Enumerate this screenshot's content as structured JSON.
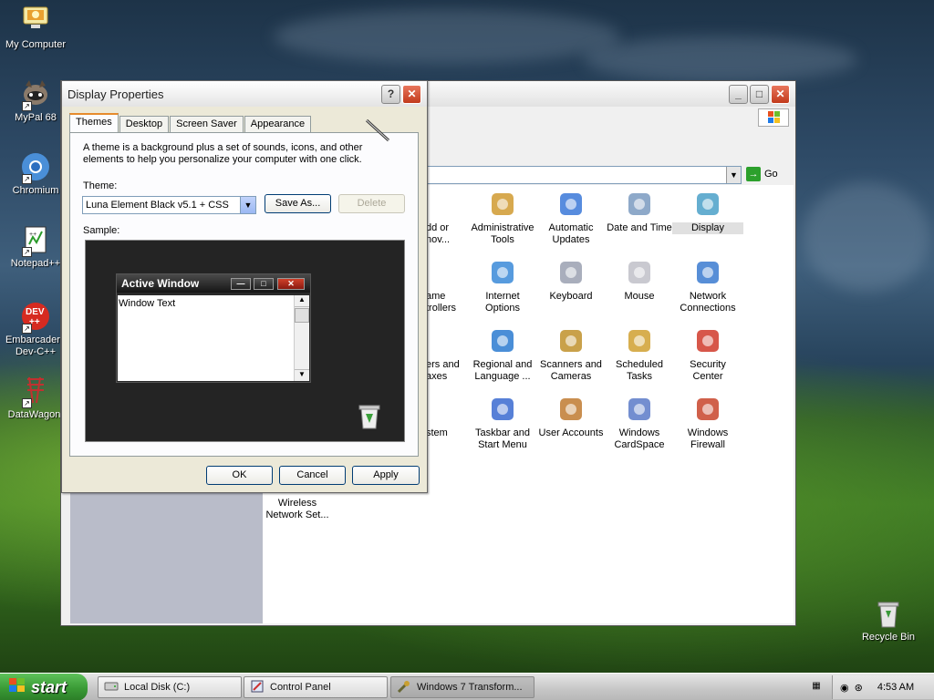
{
  "desktop": {
    "icons": [
      {
        "label": "My Computer"
      },
      {
        "label": "MyPal 68"
      },
      {
        "label": "Chromium"
      },
      {
        "label": "Notepad++"
      },
      {
        "label": "Embarcadero Dev-C++"
      },
      {
        "label": "DataWagon."
      },
      {
        "label": "Recycle Bin"
      }
    ]
  },
  "control_panel": {
    "go_label": "Go",
    "items": [
      {
        "label": "dd or\nnov..."
      },
      {
        "label": "Administrative\nTools"
      },
      {
        "label": "Automatic\nUpdates"
      },
      {
        "label": "Date and Time"
      },
      {
        "label": "Display"
      },
      {
        "label": "ame\ntrollers"
      },
      {
        "label": "Internet\nOptions"
      },
      {
        "label": "Keyboard"
      },
      {
        "label": "Mouse"
      },
      {
        "label": "Network\nConnections"
      },
      {
        "label": "ers and\naxes"
      },
      {
        "label": "Regional and\nLanguage ..."
      },
      {
        "label": "Scanners and\nCameras"
      },
      {
        "label": "Scheduled\nTasks"
      },
      {
        "label": "Security\nCenter"
      },
      {
        "label": "stem"
      },
      {
        "label": "Taskbar and\nStart Menu"
      },
      {
        "label": "User Accounts"
      },
      {
        "label": "Windows\nCardSpace"
      },
      {
        "label": "Windows\nFirewall"
      },
      {
        "label": "Wireless\nNetwork Set..."
      }
    ]
  },
  "dialog": {
    "title": "Display Properties",
    "tabs": [
      "Themes",
      "Desktop",
      "Screen Saver",
      "Appearance"
    ],
    "description": "A theme is a background plus a set of sounds, icons, and other elements to help you personalize your computer with one click.",
    "theme_label": "Theme:",
    "theme_value": "Luna Element Black v5.1 + CSS",
    "save_as": "Save As...",
    "delete": "Delete",
    "sample_label": "Sample:",
    "sample_window_title": "Active Window",
    "sample_window_text": "Window Text",
    "ok": "OK",
    "cancel": "Cancel",
    "apply": "Apply"
  },
  "taskbar": {
    "start": "start",
    "tasks": [
      {
        "label": "Local Disk (C:)"
      },
      {
        "label": "Control Panel"
      },
      {
        "label": "Windows 7 Transform..."
      }
    ],
    "clock": "4:53 AM"
  }
}
